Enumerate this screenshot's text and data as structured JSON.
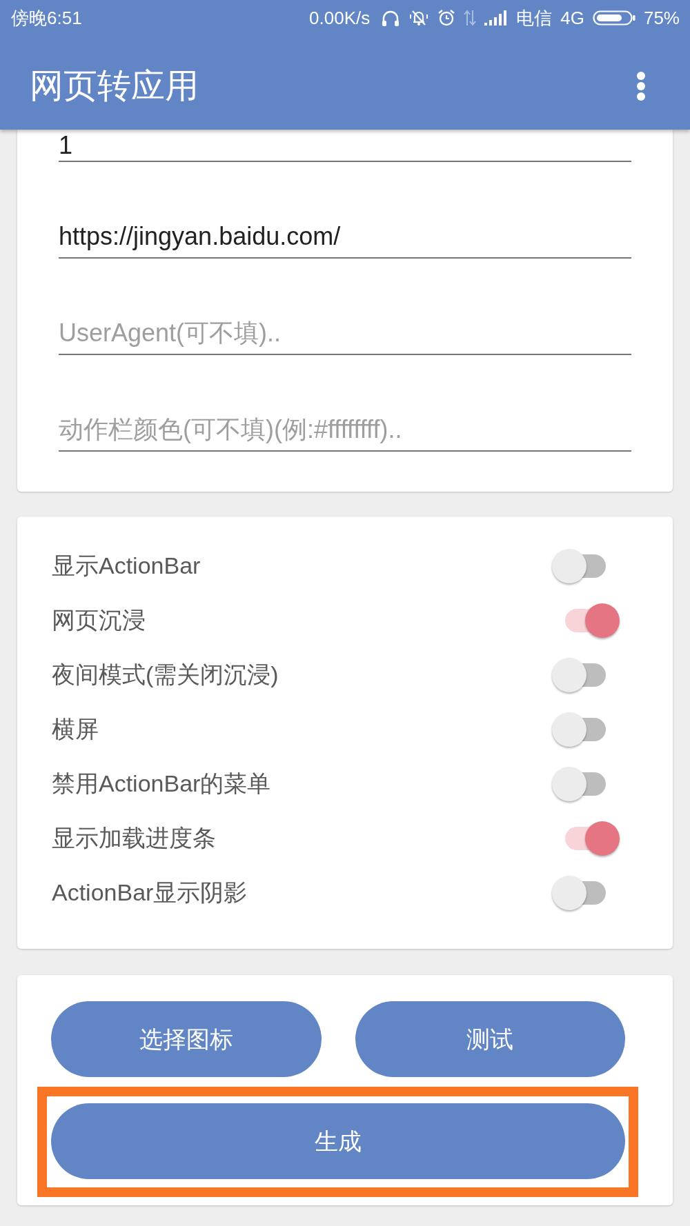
{
  "status_bar": {
    "time": "傍晚6:51",
    "net_speed": "0.00K/s",
    "carrier": "电信",
    "network": "4G",
    "battery": "75%"
  },
  "app_bar": {
    "title": "网页转应用"
  },
  "fields": [
    {
      "value": "1"
    },
    {
      "value": "https://jingyan.baidu.com/"
    },
    {
      "placeholder": "UserAgent(可不填).."
    },
    {
      "placeholder": "动作栏颜色(可不填)(例:#ffffffff).."
    }
  ],
  "toggles": [
    {
      "label": "显示ActionBar",
      "on": false
    },
    {
      "label": "网页沉浸",
      "on": true
    },
    {
      "label": "夜间模式(需关闭沉浸)",
      "on": false
    },
    {
      "label": "横屏",
      "on": false
    },
    {
      "label": "禁用ActionBar的菜单",
      "on": false
    },
    {
      "label": "显示加载进度条",
      "on": true
    },
    {
      "label": "ActionBar显示阴影",
      "on": false
    }
  ],
  "buttons": [
    {
      "label": "选择图标",
      "highlighted": false
    },
    {
      "label": "测试",
      "highlighted": false
    },
    {
      "label": "生成",
      "highlighted": true
    }
  ]
}
